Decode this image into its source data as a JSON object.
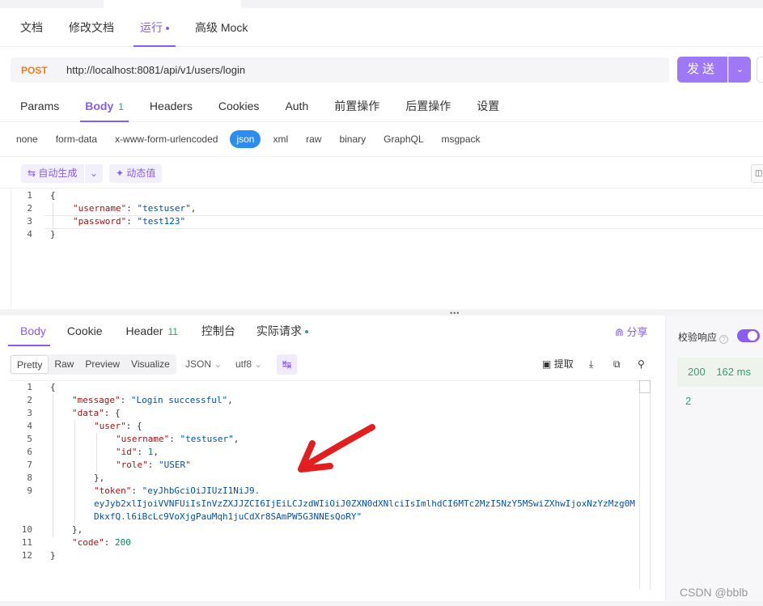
{
  "top_tabs": [
    {
      "label": "文档"
    },
    {
      "label": "修改文档"
    },
    {
      "label": "运行"
    },
    {
      "label": "高级 Mock"
    }
  ],
  "request": {
    "method": "POST",
    "url": "http://localhost:8081/api/v1/users/login",
    "send_label": "发送"
  },
  "req_tabs": [
    {
      "label": "Params"
    },
    {
      "label": "Body",
      "count": "1"
    },
    {
      "label": "Headers"
    },
    {
      "label": "Cookies"
    },
    {
      "label": "Auth"
    },
    {
      "label": "前置操作"
    },
    {
      "label": "后置操作"
    },
    {
      "label": "设置"
    }
  ],
  "body_types": [
    "none",
    "form-data",
    "x-www-form-urlencoded",
    "json",
    "xml",
    "raw",
    "binary",
    "GraphQL",
    "msgpack"
  ],
  "body_active": "json",
  "body_tools": {
    "auto_generate": "自动生成",
    "dynamic_value": "动态值"
  },
  "request_body_lines": [
    {
      "num": "1",
      "text": "{"
    },
    {
      "num": "2",
      "key": "\"username\"",
      "value": "\"testuser\"",
      "trail": ","
    },
    {
      "num": "3",
      "key": "\"password\"",
      "value": "\"test123\"",
      "trail": ""
    },
    {
      "num": "4",
      "text": "}"
    }
  ],
  "resp_tabs": [
    {
      "label": "Body"
    },
    {
      "label": "Cookie"
    },
    {
      "label": "Header",
      "count": "11"
    },
    {
      "label": "控制台"
    },
    {
      "label": "实际请求"
    }
  ],
  "share_label": "分享",
  "view_modes": [
    "Pretty",
    "Raw",
    "Preview",
    "Visualize"
  ],
  "format_select": "JSON",
  "encoding_select": "utf8",
  "extract_label": "提取",
  "verify_label": "校验响应",
  "status": {
    "code": "200",
    "time": "162 ms",
    "extra": "2"
  },
  "response_body_lines": [
    {
      "num": "1",
      "indent": 0,
      "parts": [
        [
          "p",
          "{"
        ]
      ]
    },
    {
      "num": "2",
      "indent": 1,
      "parts": [
        [
          "k",
          "\"message\""
        ],
        [
          "p",
          ": "
        ],
        [
          "s",
          "\"Login successful\""
        ],
        [
          "p",
          ","
        ]
      ]
    },
    {
      "num": "3",
      "indent": 1,
      "parts": [
        [
          "k",
          "\"data\""
        ],
        [
          "p",
          ": {"
        ]
      ]
    },
    {
      "num": "4",
      "indent": 2,
      "parts": [
        [
          "k",
          "\"user\""
        ],
        [
          "p",
          ": {"
        ]
      ]
    },
    {
      "num": "5",
      "indent": 3,
      "parts": [
        [
          "k",
          "\"username\""
        ],
        [
          "p",
          ": "
        ],
        [
          "s",
          "\"testuser\""
        ],
        [
          "p",
          ","
        ]
      ]
    },
    {
      "num": "6",
      "indent": 3,
      "parts": [
        [
          "k",
          "\"id\""
        ],
        [
          "p",
          ": "
        ],
        [
          "n",
          "1"
        ],
        [
          "p",
          ","
        ]
      ]
    },
    {
      "num": "7",
      "indent": 3,
      "parts": [
        [
          "k",
          "\"role\""
        ],
        [
          "p",
          ": "
        ],
        [
          "s",
          "\"USER\""
        ]
      ]
    },
    {
      "num": "8",
      "indent": 2,
      "parts": [
        [
          "p",
          "},"
        ]
      ]
    },
    {
      "num": "9",
      "indent": 2,
      "parts": [
        [
          "k",
          "\"token\""
        ],
        [
          "p",
          ": "
        ],
        [
          "s",
          "\"eyJhbGciOiJIUzI1NiJ9."
        ]
      ]
    },
    {
      "num": "",
      "indent": 2,
      "parts": [
        [
          "s",
          "eyJyb2xlIjoiVVNFUiIsInVzZXJJZCI6IjEiLCJzdWIiOiJ0ZXN0dXNlciIsImlhdCI6MTc2MzI5NzY5MSwiZXhwIjoxNzYzMzg0M"
        ]
      ]
    },
    {
      "num": "",
      "indent": 2,
      "parts": [
        [
          "s",
          "DkxfQ.l6iBcLc9VoXjgPauMqh1juCdXr8SAmPW5G3NNEsQoRY\""
        ]
      ]
    },
    {
      "num": "10",
      "indent": 1,
      "parts": [
        [
          "p",
          "},"
        ]
      ]
    },
    {
      "num": "11",
      "indent": 1,
      "parts": [
        [
          "k",
          "\"code\""
        ],
        [
          "p",
          ": "
        ],
        [
          "n",
          "200"
        ]
      ]
    },
    {
      "num": "12",
      "indent": 0,
      "parts": [
        [
          "p",
          "}"
        ]
      ]
    }
  ],
  "watermark": "CSDN @bblb",
  "colors": {
    "accent": "#8a5cf6",
    "method": "#f57c17",
    "json_badge": "#2d8cf0",
    "success": "#33a06f",
    "arrow": "#e31e1e"
  }
}
